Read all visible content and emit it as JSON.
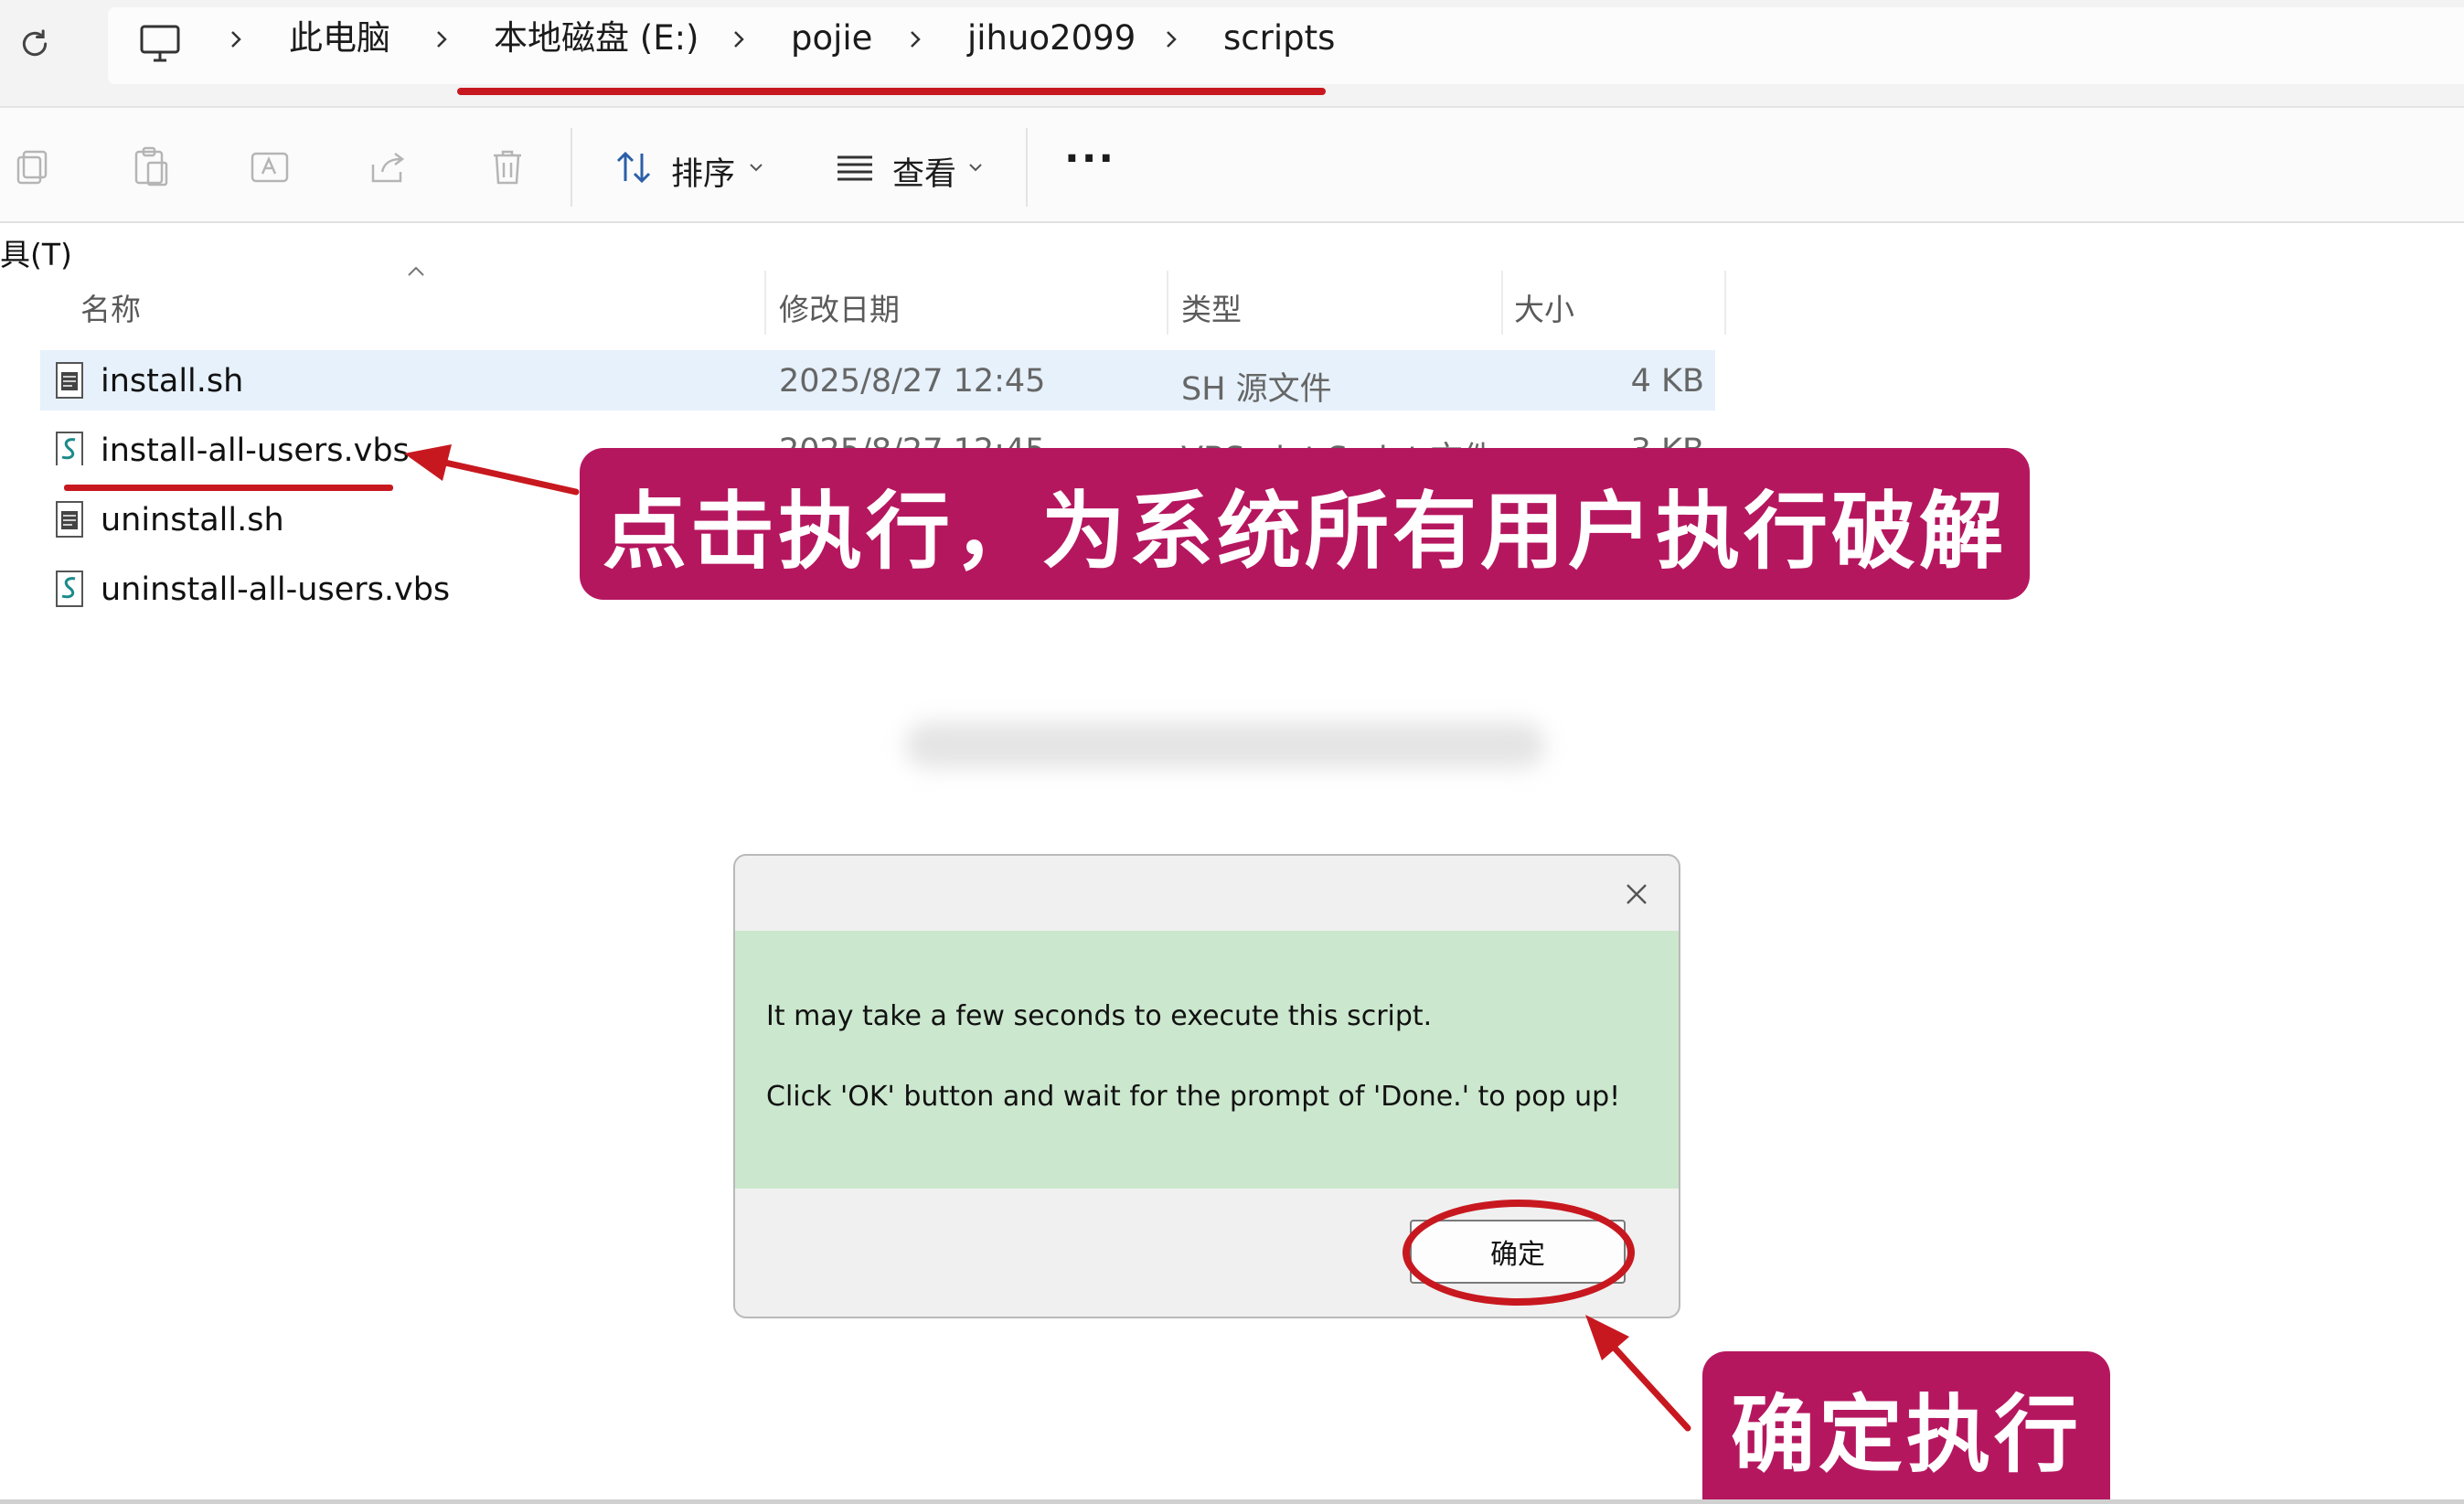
{
  "breadcrumb": {
    "items": [
      "此电脑",
      "本地磁盘 (E:)",
      "pojie",
      "jihuo2099",
      "scripts"
    ]
  },
  "toolbar": {
    "sort_label": "排序",
    "view_label": "查看",
    "more_label": "···"
  },
  "menu": {
    "tools_label": "具(T)"
  },
  "table": {
    "columns": [
      "名称",
      "修改日期",
      "类型",
      "大小"
    ],
    "rows": [
      {
        "name": "install.sh",
        "date": "2025/8/27 12:45",
        "type": "SH 源文件",
        "size": "4 KB",
        "icon": "sh-file-icon"
      },
      {
        "name": "install-all-users.vbs",
        "date": "2025/8/27 12:45",
        "type": "VBScript Script 文件",
        "size": "3 KB",
        "icon": "vbs-file-icon"
      },
      {
        "name": "uninstall.sh",
        "date": "",
        "type": "",
        "size": "",
        "icon": "sh-file-icon"
      },
      {
        "name": "uninstall-all-users.vbs",
        "date": "",
        "type": "",
        "size": "",
        "icon": "vbs-file-icon"
      }
    ]
  },
  "callouts": {
    "run_all_users": "点击执行，为系统所有用户执行破解",
    "confirm_run": "确定执行"
  },
  "dialog": {
    "line1": "It may take a few seconds to execute this script.",
    "line2": "Click 'OK' button and wait for the prompt of 'Done.' to pop up!",
    "ok_label": "确定"
  },
  "colors": {
    "callout_bg": "#b5175f",
    "annotation_red": "#c8181f",
    "dialog_body": "#cbe7cd",
    "selected_row": "#e6f1fb"
  }
}
